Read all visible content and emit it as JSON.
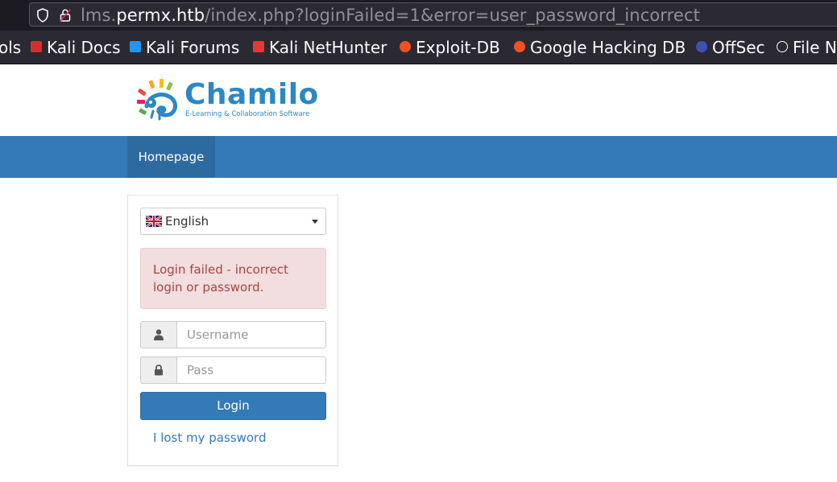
{
  "browser": {
    "url_prefix": "lms.",
    "url_host": "permx.htb",
    "url_path": "/index.php?loginFailed=1&error=user_password_incorrect",
    "bookmarks": [
      {
        "label": "ols",
        "icon": "none"
      },
      {
        "label": "Kali Docs",
        "icon": "kali-docs-icon"
      },
      {
        "label": "Kali Forums",
        "icon": "kali-forums-icon"
      },
      {
        "label": "Kali NetHunter",
        "icon": "kali-nethunter-icon"
      },
      {
        "label": "Exploit-DB",
        "icon": "exploit-db-icon"
      },
      {
        "label": "Google Hacking DB",
        "icon": "google-hacking-db-icon"
      },
      {
        "label": "OffSec",
        "icon": "offsec-icon"
      },
      {
        "label": "File N",
        "icon": "globe-icon"
      }
    ]
  },
  "header": {
    "logo_name": "Chamilo",
    "logo_tagline": "E-Learning & Collaboration Software"
  },
  "nav": {
    "items": [
      {
        "label": "Homepage",
        "active": true
      }
    ]
  },
  "login": {
    "language": "English",
    "alert": "Login failed - incorrect login or password.",
    "username_placeholder": "Username",
    "username_value": "",
    "password_placeholder": "Pass",
    "password_value": "",
    "login_button": "Login",
    "lost_password_link": "I lost my password"
  },
  "colors": {
    "brand": "#2c87c6",
    "navbar": "#337ab7",
    "nav_active": "#2d6aa0",
    "alert_bg": "#f2dede",
    "alert_text": "#a94442"
  }
}
